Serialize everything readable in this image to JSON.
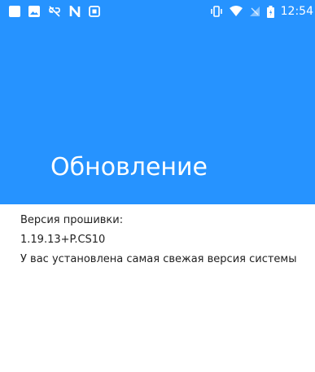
{
  "status_bar": {
    "time": "12:54",
    "left_icons": [
      "notification-square-icon",
      "image-icon",
      "link-off-icon",
      "n-icon",
      "screenshot-icon"
    ],
    "right_icons": [
      "vibrate-icon",
      "wifi-icon",
      "no-signal-icon",
      "battery-icon"
    ]
  },
  "header": {
    "title": "Обновление",
    "color": "#2693ff"
  },
  "content": {
    "firmware_label": "Версия прошивки:",
    "firmware_version": "1.19.13+P.CS10",
    "status_message": "У вас установлена самая свежая версия системы"
  }
}
